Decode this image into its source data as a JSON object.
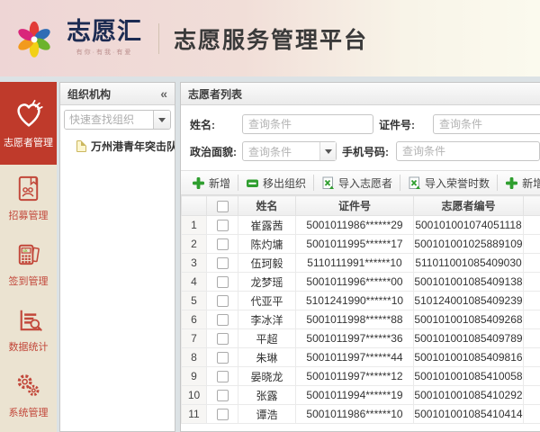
{
  "header": {
    "logo_name": "志愿汇",
    "logo_tagline": "有你·有我·有爱",
    "app_title": "志愿服务管理平台"
  },
  "sidebar": {
    "items": [
      {
        "label": "志愿者管理",
        "icon": "heart-hand-icon",
        "active": true
      },
      {
        "label": "招募管理",
        "icon": "recruit-book-icon",
        "active": false
      },
      {
        "label": "签到管理",
        "icon": "checkin-terminal-icon",
        "active": false
      },
      {
        "label": "数据统计",
        "icon": "stats-chart-icon",
        "active": false
      },
      {
        "label": "系统管理",
        "icon": "gears-icon",
        "active": false
      }
    ]
  },
  "org_panel": {
    "title": "组织机构",
    "collapse_glyph": "«",
    "search_placeholder": "快速查找组织",
    "tree": [
      {
        "label": "万州港青年突击队",
        "icon": "document-icon"
      }
    ]
  },
  "volunteer_panel": {
    "title": "志愿者列表",
    "filters": {
      "name_label": "姓名:",
      "name_placeholder": "查询条件",
      "cert_label": "证件号:",
      "cert_placeholder": "查询条件",
      "political_label": "政治面貌:",
      "political_placeholder": "查询条件",
      "phone_label": "手机号码:",
      "phone_placeholder": "查询条件"
    },
    "toolbar": [
      {
        "label": "新增",
        "icon": "plus-icon"
      },
      {
        "label": "移出组织",
        "icon": "minus-icon"
      },
      {
        "label": "导入志愿者",
        "icon": "excel-import-icon"
      },
      {
        "label": "导入荣誉时数",
        "icon": "excel-import-icon"
      },
      {
        "label": "新增荣誉时数",
        "icon": "plus-icon"
      }
    ],
    "table": {
      "columns": {
        "name": "姓名",
        "cert": "证件号",
        "vol_no": "志愿者编号"
      },
      "rows": [
        {
          "num": "1",
          "name": "崔露茜",
          "cert": "5001011986******29",
          "vol_no": "500101001074051118"
        },
        {
          "num": "2",
          "name": "陈灼墉",
          "cert": "5001011995******17",
          "vol_no": "500101001025889109"
        },
        {
          "num": "3",
          "name": "伍珂毅",
          "cert": "5110111991******10",
          "vol_no": "511011001085409030"
        },
        {
          "num": "4",
          "name": "龙梦瑶",
          "cert": "5001011996******00",
          "vol_no": "500101001085409138"
        },
        {
          "num": "5",
          "name": "代亚平",
          "cert": "5101241990******10",
          "vol_no": "510124001085409239"
        },
        {
          "num": "6",
          "name": "李冰洋",
          "cert": "5001011998******88",
          "vol_no": "500101001085409268"
        },
        {
          "num": "7",
          "name": "平超",
          "cert": "5001011997******36",
          "vol_no": "500101001085409789"
        },
        {
          "num": "8",
          "name": "朱琳",
          "cert": "5001011997******44",
          "vol_no": "500101001085409816"
        },
        {
          "num": "9",
          "name": "晏晓龙",
          "cert": "5001011997******12",
          "vol_no": "500101001085410058"
        },
        {
          "num": "10",
          "name": "张露",
          "cert": "5001011994******19",
          "vol_no": "500101001085410292"
        },
        {
          "num": "11",
          "name": "谭浩",
          "cert": "5001011986******10",
          "vol_no": "500101001085410414"
        }
      ]
    }
  },
  "colors": {
    "active_red": "#bf3a2b",
    "sidebar_cream": "#ebe3d1",
    "accent_green": "#2f9e2f",
    "header_pink": "#eed5d5",
    "header_cream": "#fbfaee"
  }
}
